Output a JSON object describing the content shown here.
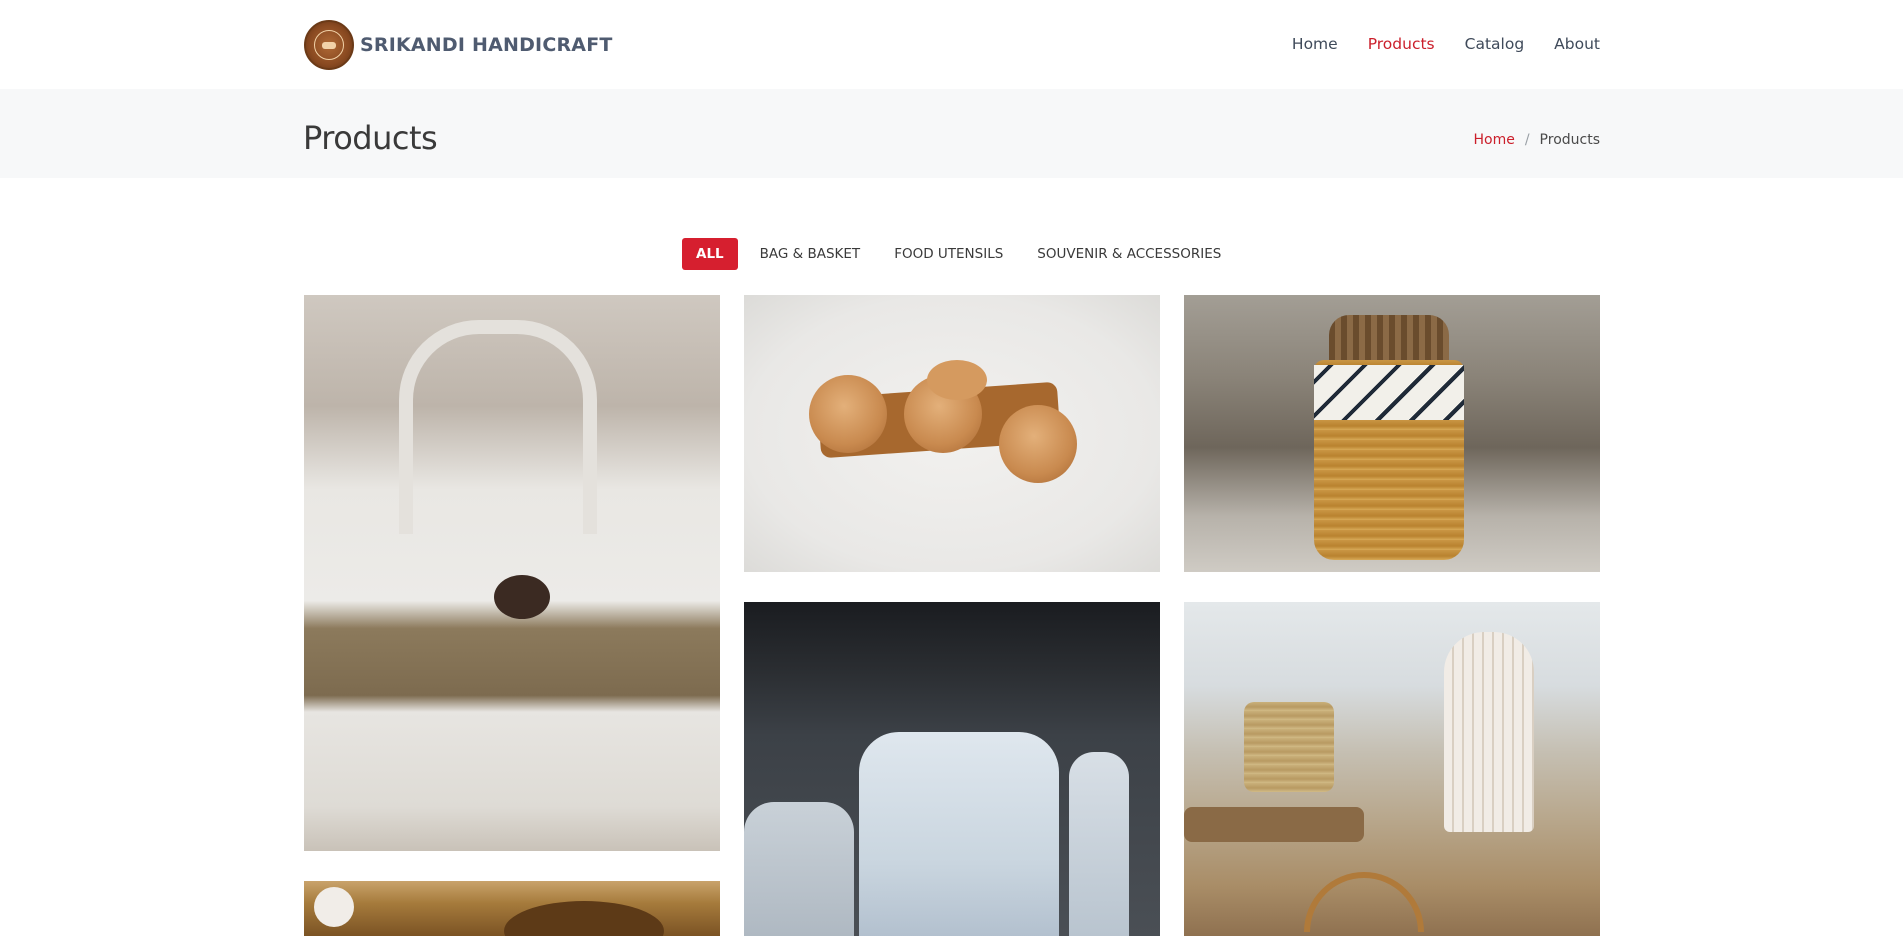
{
  "header": {
    "brand_name": "SRIKANDI HANDICRAFT",
    "logo_icon": "srikandi-logo-icon",
    "nav": [
      {
        "label": "Home",
        "active": false
      },
      {
        "label": "Products",
        "active": true
      },
      {
        "label": "Catalog",
        "active": false
      },
      {
        "label": "About",
        "active": false
      }
    ]
  },
  "page": {
    "title": "Products",
    "breadcrumb": {
      "home": "Home",
      "separator": "/",
      "current": "Products"
    }
  },
  "filters": [
    {
      "label": "ALL",
      "active": true
    },
    {
      "label": "BAG & BASKET",
      "active": false
    },
    {
      "label": "FOOD UTENSILS",
      "active": false
    },
    {
      "label": "SOUVENIR & ACCESSORIES",
      "active": false
    }
  ],
  "gallery": [
    {
      "subject": "white woven bag with brown stripe"
    },
    {
      "subject": "wooden bowls on tray"
    },
    {
      "subject": "striped woven basket"
    },
    {
      "subject": "white distressed wooden objects"
    },
    {
      "subject": "craft shop interior with baskets"
    },
    {
      "subject": "woven items (partially visible)"
    }
  ],
  "colors": {
    "accent": "#cb1f2b",
    "filter_active_bg": "#d61f2f",
    "title_band_bg": "#f7f8f9",
    "brand_text": "#4f5b70"
  }
}
